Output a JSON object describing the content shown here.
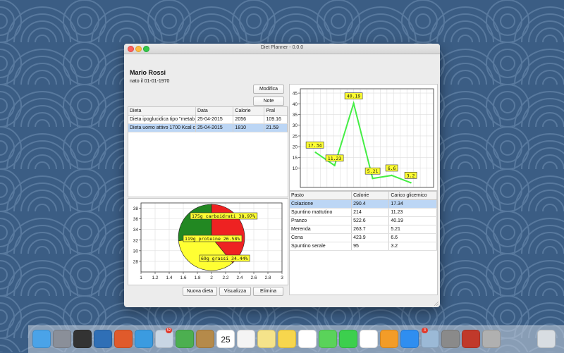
{
  "window": {
    "title": "Diet Planner - 0.0.0"
  },
  "patient": {
    "name": "Mario Rossi",
    "birth": "nato il 01-01-1970"
  },
  "buttons": {
    "modifica": "Modifica",
    "note": "Note",
    "nuova": "Nuova dieta",
    "visualizza": "Visualizza",
    "elimina": "Elimina"
  },
  "diets": {
    "headers": [
      "Dieta",
      "Data",
      "Calorie",
      "Pral"
    ],
    "rows": [
      {
        "dieta": "Dieta ipoglucidica tipo \"metab",
        "data": "25-04-2015",
        "calorie": "2056",
        "pral": "109.16"
      },
      {
        "dieta": "Dieta uomo attivo 1700 Kcal c",
        "data": "25-04-2015",
        "calorie": "1810",
        "pral": "21.59"
      }
    ]
  },
  "meals": {
    "headers": [
      "Pasto",
      "Calorie",
      "Carico glicemico"
    ],
    "rows": [
      {
        "pasto": "Colazione",
        "calorie": "290.4",
        "cg": "17.34"
      },
      {
        "pasto": "Spuntino mattutino",
        "calorie": "214",
        "cg": "11.23"
      },
      {
        "pasto": "Pranzo",
        "calorie": "522.6",
        "cg": "40.19"
      },
      {
        "pasto": "Merenda",
        "calorie": "263.7",
        "cg": "5.21"
      },
      {
        "pasto": "Cena",
        "calorie": "423.9",
        "cg": "6.6"
      },
      {
        "pasto": "Spuntino serale",
        "calorie": "95",
        "cg": "3.2"
      }
    ]
  },
  "colors": {
    "line": "#44ee44",
    "label_bg": "#ffff33",
    "pie_red": "#ee2222",
    "pie_green": "#228822",
    "pie_yellow": "#ffff33",
    "selection": "#bcd6f5"
  },
  "chart_data": [
    {
      "type": "line",
      "x": [
        1,
        2,
        3,
        4,
        5,
        6
      ],
      "y": [
        17.34,
        11.23,
        40.19,
        5.21,
        6.6,
        3.2
      ],
      "data_labels": [
        "17.34",
        "11.23",
        "40.19",
        "5.21",
        "6.6",
        "3.2"
      ],
      "xlim": [
        0.2,
        7.2
      ],
      "ylim": [
        1,
        47
      ],
      "yticks": [
        "10",
        "15",
        "20",
        "25",
        "30",
        "35",
        "40",
        "45"
      ],
      "grid": true,
      "title": "",
      "xlabel": "",
      "ylabel": ""
    },
    {
      "type": "pie",
      "slices": [
        {
          "label": "175g carboidrati 38.97%",
          "value": 38.97,
          "color": "#ee2222"
        },
        {
          "label": "69g grassi 34.44%",
          "value": 34.44,
          "color": "#ffff33"
        },
        {
          "label": "119g proteine 26.58%",
          "value": 26.58,
          "color": "#228822"
        }
      ],
      "xticks": [
        "1",
        "1.2",
        "1.4",
        "1.6",
        "1.8",
        "2",
        "2.2",
        "2.4",
        "2.6",
        "2.8",
        "3"
      ],
      "yticks": [
        "28",
        "30",
        "32",
        "34",
        "36",
        "38"
      ],
      "xlim": [
        1,
        3
      ],
      "ylim": [
        26,
        39
      ],
      "grid": true,
      "title": ""
    }
  ],
  "dock": {
    "icons": [
      "finder-icon",
      "launchpad-icon",
      "mission-control-icon",
      "virtualbox-icon",
      "bookmarks-icon",
      "safari-icon",
      "preview-icon",
      "numbers-icon",
      "contacts-icon",
      "calendar-icon",
      "reminders-icon",
      "notes-icon",
      "stickies-icon",
      "photos-icon",
      "messages-icon",
      "facetime-icon",
      "music-icon",
      "ibooks-icon",
      "appstore-icon",
      "dieta-icon",
      "system-preferences-icon",
      "photo-booth-icon",
      "script-editor-icon",
      "trash-icon"
    ],
    "badges": {
      "preview": "52",
      "appstore": "3"
    },
    "calendar_day": "25"
  }
}
